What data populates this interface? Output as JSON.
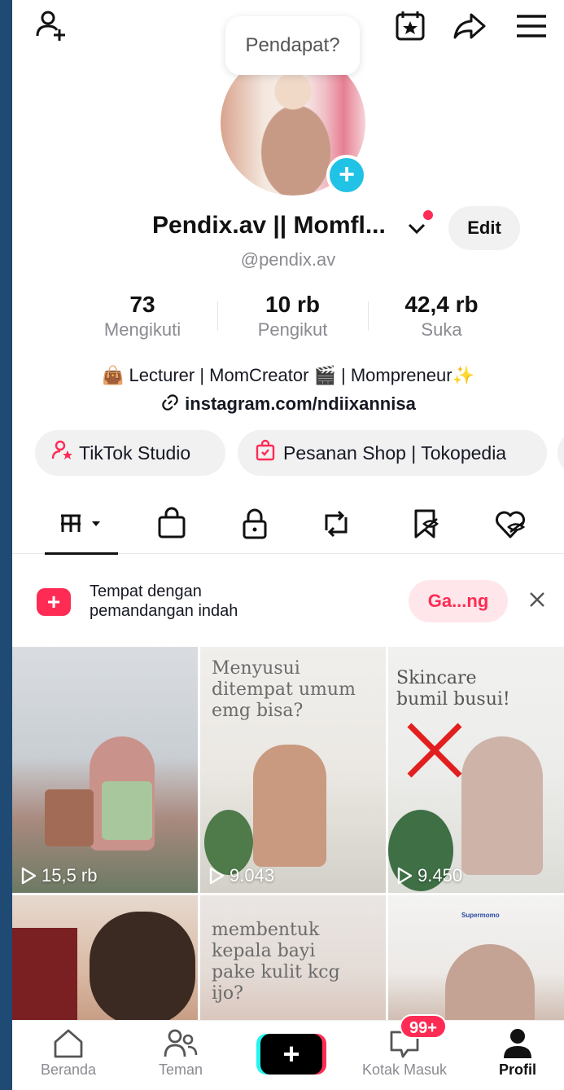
{
  "header": {
    "feedback_bubble": "Pendapat?"
  },
  "profile": {
    "display_name": "Pendix.av || Momfl...",
    "edit_label": "Edit",
    "handle": "@pendix.av"
  },
  "stats": [
    {
      "value": "73",
      "label": "Mengikuti"
    },
    {
      "value": "10 rb",
      "label": "Pengikut"
    },
    {
      "value": "42,4 rb",
      "label": "Suka"
    }
  ],
  "bio": {
    "line1": "👜 Lecturer | MomCreator 🎬 | Mompreneur✨",
    "link": "instagram.com/ndiixannisa"
  },
  "chips": {
    "studio": "TikTok Studio",
    "shop": "Pesanan Shop | Tokopedia"
  },
  "promo": {
    "text_line1": "Tempat dengan",
    "text_line2": "pemandangan indah",
    "button": "Ga...ng"
  },
  "videos": [
    {
      "views": "15,5 rb",
      "caption": ""
    },
    {
      "views": "9.043",
      "caption_lines": [
        "Menyusui",
        "ditempat umum",
        "emg bisa?"
      ]
    },
    {
      "views": "9.450",
      "caption_lines": [
        "Skincare",
        "bumil busui!"
      ]
    },
    {
      "views": "",
      "caption": ""
    },
    {
      "views": "",
      "caption_lines": [
        "membentuk",
        "kepala bayi",
        "pake kulit kcg",
        "ijo?"
      ]
    },
    {
      "views": "",
      "caption_lines": [
        "Supermomo"
      ]
    }
  ],
  "bottom_nav": {
    "home": "Beranda",
    "friends": "Teman",
    "inbox": "Kotak Masuk",
    "inbox_badge": "99+",
    "profile": "Profil"
  },
  "colors": {
    "accent": "#fe2c55",
    "cyan": "#20c2e5",
    "frame": "#1f4a73"
  }
}
